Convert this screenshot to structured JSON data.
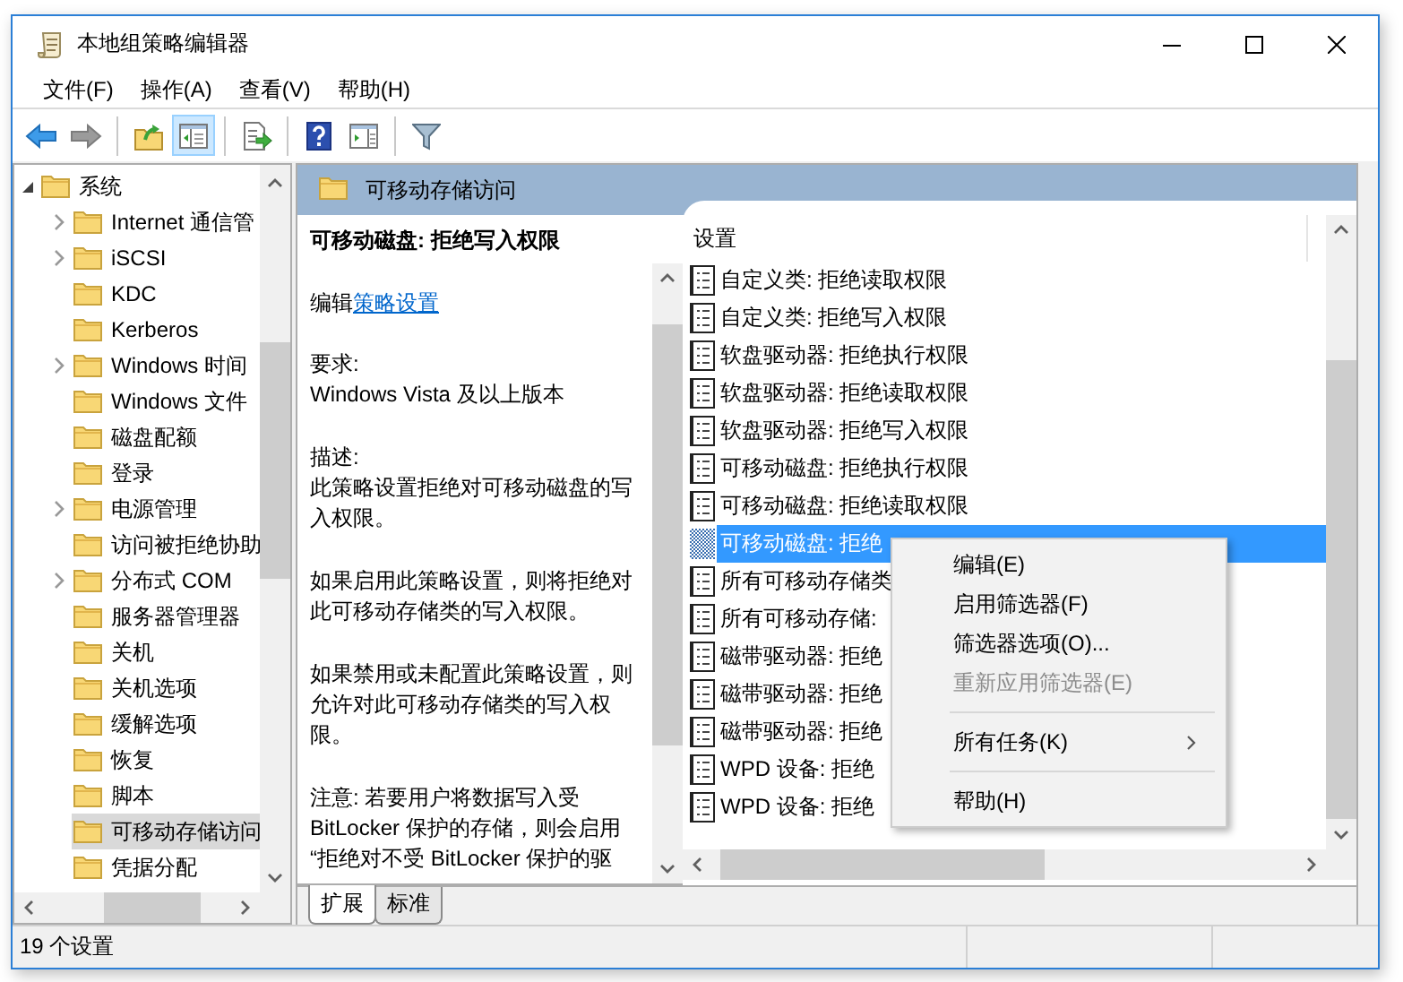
{
  "window": {
    "title": "本地组策略编辑器"
  },
  "menu": [
    "文件(F)",
    "操作(A)",
    "查看(V)",
    "帮助(H)"
  ],
  "toolbar": [
    {
      "kind": "back",
      "pressed": false,
      "disabled": false
    },
    {
      "kind": "forward",
      "pressed": false,
      "disabled": true
    },
    {
      "kind": "separator"
    },
    {
      "kind": "up",
      "pressed": false,
      "disabled": false
    },
    {
      "kind": "tree",
      "pressed": true,
      "disabled": false
    },
    {
      "kind": "separator"
    },
    {
      "kind": "export",
      "pressed": false,
      "disabled": false
    },
    {
      "kind": "separator"
    },
    {
      "kind": "help",
      "pressed": false,
      "disabled": false
    },
    {
      "kind": "view",
      "pressed": false,
      "disabled": false
    },
    {
      "kind": "separator"
    },
    {
      "kind": "filter",
      "pressed": false,
      "disabled": false
    }
  ],
  "tree": [
    {
      "label": "系统",
      "expanded": true,
      "selected": false,
      "children": [
        {
          "label": "Internet 通信管",
          "expandable": true,
          "selected": false
        },
        {
          "label": "iSCSI",
          "expandable": true,
          "selected": false
        },
        {
          "label": "KDC",
          "expandable": false,
          "selected": false
        },
        {
          "label": "Kerberos",
          "expandable": false,
          "selected": false
        },
        {
          "label": "Windows 时间",
          "expandable": true,
          "selected": false
        },
        {
          "label": "Windows 文件",
          "expandable": false,
          "selected": false
        },
        {
          "label": "磁盘配额",
          "expandable": false,
          "selected": false
        },
        {
          "label": "登录",
          "expandable": false,
          "selected": false
        },
        {
          "label": "电源管理",
          "expandable": true,
          "selected": false
        },
        {
          "label": "访问被拒绝协助",
          "expandable": false,
          "selected": false
        },
        {
          "label": "分布式 COM",
          "expandable": true,
          "selected": false
        },
        {
          "label": "服务器管理器",
          "expandable": false,
          "selected": false
        },
        {
          "label": "关机",
          "expandable": false,
          "selected": false
        },
        {
          "label": "关机选项",
          "expandable": false,
          "selected": false
        },
        {
          "label": "缓解选项",
          "expandable": false,
          "selected": false
        },
        {
          "label": "恢复",
          "expandable": false,
          "selected": false
        },
        {
          "label": "脚本",
          "expandable": false,
          "selected": false
        },
        {
          "label": "可移动存储访问",
          "expandable": false,
          "selected": true
        },
        {
          "label": "凭据分配",
          "expandable": false,
          "selected": false
        }
      ]
    }
  ],
  "details": {
    "title": "可移动存储访问",
    "description": {
      "title": "可移动磁盘: 拒绝写入权限",
      "edit_prefix": "编辑",
      "edit_link": "策略设置",
      "sections": [
        {
          "heading": "要求:",
          "lines": [
            "Windows Vista 及以上版本"
          ]
        },
        {
          "heading": "描述:",
          "lines": [
            "此策略设置拒绝对可移动磁盘的写",
            "入权限。"
          ]
        },
        {
          "lines": [
            "如果启用此策略设置，则将拒绝对",
            "此可移动存储类的写入权限。"
          ]
        },
        {
          "lines": [
            "如果禁用或未配置此策略设置，则",
            "允许对此可移动存储类的写入权",
            "限。"
          ]
        },
        {
          "lines": [
            "注意: 若要用户将数据写入受",
            "BitLocker 保护的存储，则会启用",
            "“拒绝对不受 BitLocker 保护的驱"
          ]
        }
      ]
    },
    "list": {
      "column": "设置",
      "rows": [
        {
          "label": "自定义类: 拒绝读取权限",
          "selected": false
        },
        {
          "label": "自定义类: 拒绝写入权限",
          "selected": false
        },
        {
          "label": "软盘驱动器: 拒绝执行权限",
          "selected": false
        },
        {
          "label": "软盘驱动器: 拒绝读取权限",
          "selected": false
        },
        {
          "label": "软盘驱动器: 拒绝写入权限",
          "selected": false
        },
        {
          "label": "可移动磁盘: 拒绝执行权限",
          "selected": false
        },
        {
          "label": "可移动磁盘: 拒绝读取权限",
          "selected": false
        },
        {
          "label": "可移动磁盘: 拒绝",
          "selected": true
        },
        {
          "label": "所有可移动存储类",
          "selected": false
        },
        {
          "label": "所有可移动存储:",
          "selected": false
        },
        {
          "label": "磁带驱动器: 拒绝",
          "selected": false
        },
        {
          "label": "磁带驱动器: 拒绝",
          "selected": false
        },
        {
          "label": "磁带驱动器: 拒绝",
          "selected": false
        },
        {
          "label": "WPD 设备: 拒绝",
          "selected": false
        },
        {
          "label": "WPD 设备: 拒绝",
          "selected": false
        }
      ]
    },
    "tabs": [
      {
        "label": "扩展",
        "selected": true
      },
      {
        "label": "标准",
        "selected": false
      }
    ]
  },
  "context_menu": {
    "items": [
      {
        "kind": "item",
        "label": "编辑(E)",
        "disabled": false
      },
      {
        "kind": "item",
        "label": "启用筛选器(F)",
        "disabled": false
      },
      {
        "kind": "item",
        "label": "筛选器选项(O)...",
        "disabled": false
      },
      {
        "kind": "item",
        "label": "重新应用筛选器(E)",
        "disabled": true
      },
      {
        "kind": "separator"
      },
      {
        "kind": "submenu",
        "label": "所有任务(K)",
        "disabled": false
      },
      {
        "kind": "separator"
      },
      {
        "kind": "item",
        "label": "帮助(H)",
        "disabled": false
      }
    ]
  },
  "status_bar": {
    "text": "19 个设置"
  }
}
